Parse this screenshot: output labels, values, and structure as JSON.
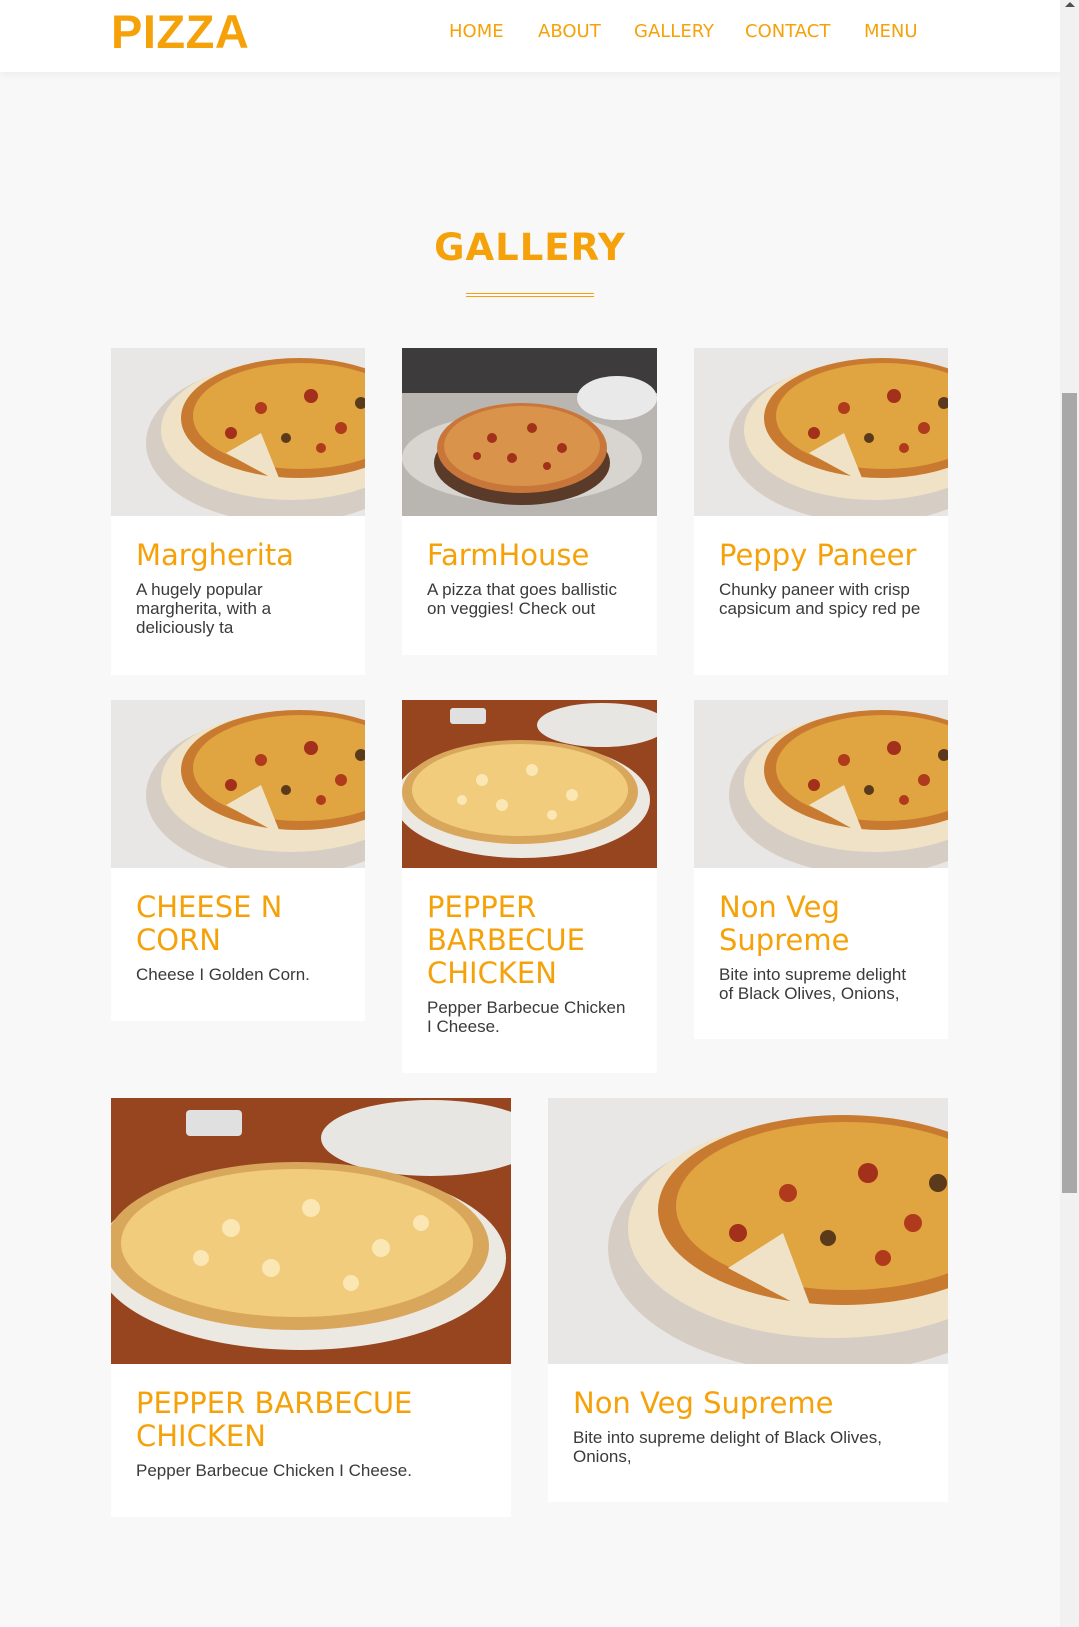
{
  "header": {
    "logo": "PIZZA",
    "nav": [
      "HOME",
      "ABOUT",
      "GALLERY",
      "CONTACT",
      "MENU"
    ]
  },
  "gallery": {
    "title": "GALLERY",
    "cards": [
      {
        "title": "Margherita",
        "text": "A hugely popular margherita, with a deliciously ta",
        "image": "pizza-on-board-photo"
      },
      {
        "title": "FarmHouse",
        "text": "A pizza that goes ballistic on veggies! Check out",
        "image": "pizza-on-table-photo"
      },
      {
        "title": "Peppy Paneer",
        "text": "Chunky paneer with crisp capsicum and spicy red pe",
        "image": "pizza-on-board-photo"
      },
      {
        "title": "CHEESE N CORN",
        "text": "Cheese I Golden Corn.",
        "image": "pizza-on-board-photo"
      },
      {
        "title": "PEPPER BARBECUE CHICKEN",
        "text": "Pepper Barbecue Chicken I Cheese.",
        "image": "cheese-pizza-on-wood-table-photo"
      },
      {
        "title": "Non Veg Supreme",
        "text": "Bite into supreme delight of Black Olives, Onions,",
        "image": "pizza-on-board-photo"
      },
      {
        "title": "PEPPER BARBECUE CHICKEN",
        "text": "Pepper Barbecue Chicken I Cheese.",
        "image": "cheese-pizza-on-wood-table-photo"
      },
      {
        "title": "Non Veg Supreme",
        "text": "Bite into supreme delight of Black Olives, Onions,",
        "image": "pizza-on-board-photo"
      }
    ]
  },
  "colors": {
    "accent": "#f5a20a",
    "background": "#f8f8f8",
    "card": "#ffffff",
    "text": "#3a3a3a"
  }
}
